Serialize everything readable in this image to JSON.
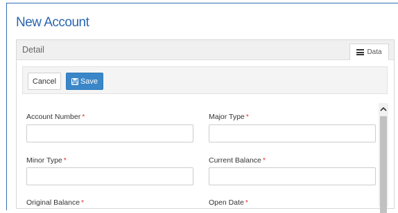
{
  "page": {
    "title": "New Account"
  },
  "panel": {
    "heading": "Detail",
    "tab_data_label": "Data"
  },
  "toolbar": {
    "cancel_label": "Cancel",
    "save_label": "Save"
  },
  "form": {
    "required_marker": "*",
    "fields": [
      {
        "label": "Account Number",
        "value": ""
      },
      {
        "label": "Major Type",
        "value": ""
      },
      {
        "label": "Minor Type",
        "value": ""
      },
      {
        "label": "Current Balance",
        "value": ""
      },
      {
        "label": "Original Balance",
        "value": ""
      },
      {
        "label": "Open Date",
        "value": ""
      }
    ]
  },
  "colors": {
    "accent": "#2a66b0",
    "primary_button": "#3a86c8",
    "required": "#e0323c"
  },
  "icons": {
    "tab_data": "list-icon",
    "save": "floppy-disk-icon",
    "scroll_up": "chevron-up-icon"
  }
}
